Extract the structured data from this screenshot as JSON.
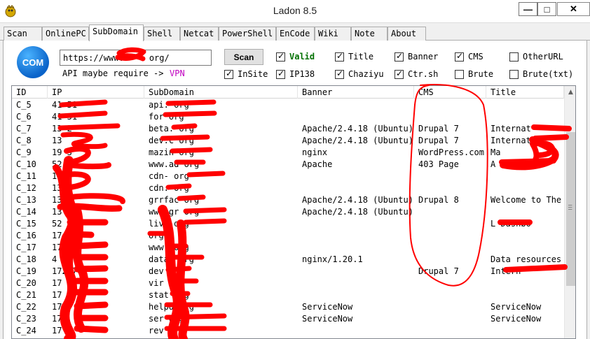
{
  "window": {
    "title": "Ladon 8.5"
  },
  "tabs": [
    "Scan",
    "OnlinePC",
    "SubDomain",
    "Shell",
    "Netcat",
    "PowerShell",
    "EnCode",
    "Wiki",
    "Note",
    "About"
  ],
  "active_tab": "SubDomain",
  "logo": {
    "text": "COM"
  },
  "url_input": {
    "value": "https://www.     org/"
  },
  "scan_button": "Scan",
  "api_hint": "API maybe require ->",
  "vpn_link": "VPN",
  "options": {
    "valid": {
      "label": "Valid",
      "checked": true
    },
    "title": {
      "label": "Title",
      "checked": true
    },
    "banner": {
      "label": "Banner",
      "checked": true
    },
    "cms": {
      "label": "CMS",
      "checked": true
    },
    "otherurl": {
      "label": "OtherURL",
      "checked": false
    },
    "insite": {
      "label": "InSite",
      "checked": true
    },
    "ip138": {
      "label": "IP138",
      "checked": true
    },
    "chaziyu": {
      "label": "Chaziyu",
      "checked": true
    },
    "ctrsh": {
      "label": "Ctr.sh",
      "checked": true
    },
    "brute": {
      "label": "Brute",
      "checked": false
    },
    "brutetxt": {
      "label": "Brute(txt)",
      "checked": false
    }
  },
  "table": {
    "columns": [
      "ID",
      "IP",
      "SubDomain",
      "Banner",
      "CMS",
      "Title"
    ],
    "rows": [
      {
        "id": "C_5",
        "ip": "41        51",
        "sub": "api.        org",
        "banner": "",
        "cms": "",
        "title": ""
      },
      {
        "id": "C_6",
        "ip": "41        51",
        "sub": "for           org",
        "banner": "",
        "cms": "",
        "title": ""
      },
      {
        "id": "C_7",
        "ip": "13         2",
        "sub": "beta.     org",
        "banner": "Apache/2.4.18 (Ubuntu)",
        "cms": "Drupal 7",
        "title": "Internat"
      },
      {
        "id": "C_8",
        "ip": "13",
        "sub": "dev.c      org",
        "banner": "Apache/2.4.18 (Ubuntu)",
        "cms": "Drupal 7",
        "title": "Internati"
      },
      {
        "id": "C_9",
        "ip": "19         3",
        "sub": "mazin       org",
        "banner": "nginx",
        "cms": "WordPress.com",
        "title": "Ma"
      },
      {
        "id": "C_10",
        "ip": "52         9",
        "sub": "www.ad         org",
        "banner": "Apache",
        "cms": "403 Page",
        "title": "A"
      },
      {
        "id": "C_11",
        "ip": "13",
        "sub": "cdn-         org",
        "banner": "",
        "cms": "",
        "title": ""
      },
      {
        "id": "C_12",
        "ip": "13",
        "sub": "cdn.     org",
        "banner": "",
        "cms": "",
        "title": ""
      },
      {
        "id": "C_13",
        "ip": "13",
        "sub": "grrfac     org",
        "banner": "Apache/2.4.18 (Ubuntu)",
        "cms": "Drupal 8",
        "title": "Welcome to The"
      },
      {
        "id": "C_14",
        "ip": "13",
        "sub": "www.gr         org",
        "banner": "Apache/2.4.18 (Ubuntu)",
        "cms": "",
        "title": ""
      },
      {
        "id": "C_15",
        "ip": "52",
        "sub": "live         org",
        "banner": "",
        "cms": "",
        "title": "L       Dashbo"
      },
      {
        "id": "C_16",
        "ip": "17         25",
        "sub": "     org",
        "banner": "",
        "cms": "",
        "title": ""
      },
      {
        "id": "C_17",
        "ip": "17",
        "sub": "www.      org",
        "banner": "",
        "cms": "",
        "title": ""
      },
      {
        "id": "C_18",
        "ip": "4",
        "sub": "data.      org",
        "banner": "nginx/1.20.1",
        "cms": "",
        "title": "Data resources"
      },
      {
        "id": "C_19",
        "ip": "172        7",
        "sub": "dev      org",
        "banner": "",
        "cms": "Drupal 7",
        "title": "Intern"
      },
      {
        "id": "C_20",
        "ip": "17",
        "sub": "vir      org",
        "banner": "",
        "cms": "",
        "title": ""
      },
      {
        "id": "C_21",
        "ip": "17",
        "sub": "stat      org",
        "banner": "",
        "cms": "",
        "title": ""
      },
      {
        "id": "C_22",
        "ip": "17",
        "sub": "helpd      org",
        "banner": "ServiceNow",
        "cms": "",
        "title": "ServiceNow"
      },
      {
        "id": "C_23",
        "ip": "17",
        "sub": "ser        org",
        "banner": "ServiceNow",
        "cms": "",
        "title": "ServiceNow"
      },
      {
        "id": "C_24",
        "ip": "17",
        "sub": "rev         org",
        "banner": "",
        "cms": "",
        "title": ""
      }
    ]
  },
  "colors": {
    "redaction": "#ff0000",
    "valid_label": "#007000",
    "vpn_link": "#c000c0",
    "logo": "#0a63c9"
  }
}
